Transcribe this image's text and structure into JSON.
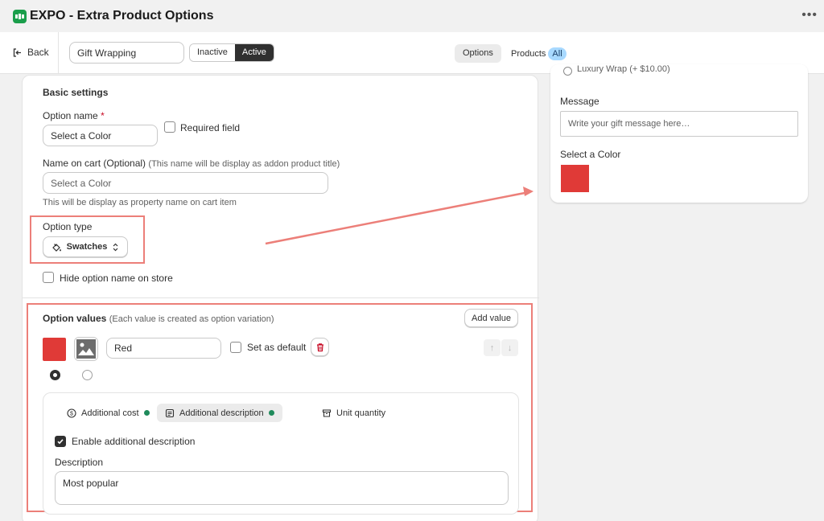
{
  "app": {
    "title": "EXPO - Extra Product Options",
    "more_icon": "more-horizontal-icon"
  },
  "toolbar": {
    "back_label": "Back",
    "option_name_value": "Gift Wrapping",
    "status": {
      "inactive": "Inactive",
      "active": "Active",
      "selected": "Active"
    },
    "tabs": {
      "options": "Options",
      "products": "Products",
      "products_badge": "All"
    }
  },
  "basic_settings": {
    "title": "Basic settings",
    "option_name_label": "Option name",
    "required_mark": "*",
    "option_name_value": "Select a Color",
    "required_field_label": "Required field",
    "required_field_checked": false,
    "cart_name_label": "Name on cart (Optional)",
    "cart_name_hint": "(This name will be display as addon product title)",
    "cart_name_placeholder": "Select a Color",
    "cart_name_help": "This will be display as property name on cart item",
    "option_type_label": "Option type",
    "option_type_value": "Swatches",
    "hide_name_label": "Hide option name on store",
    "hide_name_checked": false
  },
  "option_values": {
    "title": "Option values",
    "hint": "(Each value is created as option variation)",
    "add_value_label": "Add value",
    "items": [
      {
        "swatch_color": "#e03a37",
        "value": "Red",
        "set_default_label": "Set as default",
        "set_default_checked": false
      }
    ],
    "subtabs": {
      "additional_cost": "Additional cost",
      "additional_description": "Additional description",
      "unit_quantity": "Unit quantity",
      "selected": "Additional description"
    },
    "enable_desc_label": "Enable additional description",
    "enable_desc_checked": true,
    "description_label": "Description",
    "description_value": "Most popular"
  },
  "preview": {
    "cut_text": "Luxury Wrap (+ $10.00)",
    "message_label": "Message",
    "message_placeholder": "Write your gift message here…",
    "color_label": "Select a Color",
    "swatch_color": "#e03a37"
  },
  "colors": {
    "accent_dark": "#303030",
    "highlight": "#ec7f79",
    "status_dot": "#1f8a5b",
    "swatch_red": "#e03a37",
    "badge_blue": "#a8d9ff"
  }
}
